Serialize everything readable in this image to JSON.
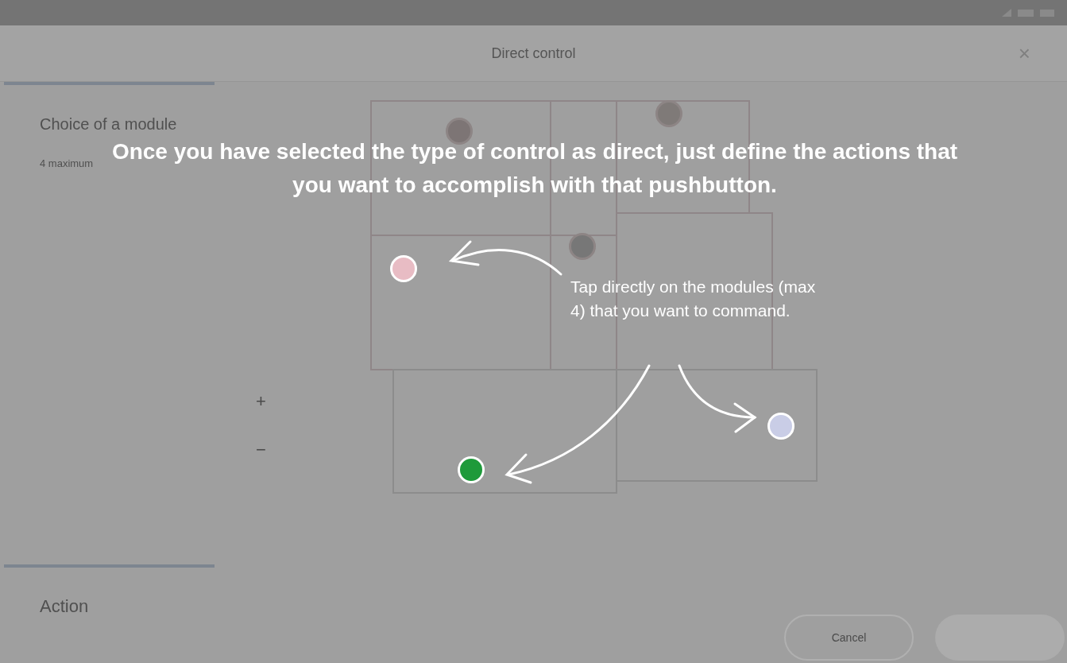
{
  "dialog": {
    "title": "Direct control",
    "close": "×"
  },
  "sidebar": {
    "module_heading": "Choice of a module",
    "module_hint": "4 maximum",
    "action_heading": "Action"
  },
  "zoom": {
    "plus": "+",
    "minus": "−"
  },
  "modules": [
    {
      "selected": false,
      "color": "#7d7575"
    },
    {
      "selected": false,
      "color": "#7f7a78"
    },
    {
      "selected": false,
      "color": "#777777"
    },
    {
      "selected": true,
      "color": "#e8bcc4"
    },
    {
      "selected": true,
      "color": "#1e9a3a"
    },
    {
      "selected": true,
      "color": "#c9cde6"
    }
  ],
  "buttons": [
    {
      "label": "Cancel",
      "kind": "outline"
    },
    {
      "kind": "filled"
    }
  ],
  "tutorial": {
    "headline": "Once you have selected the type of control as direct, just define the actions that you want to accomplish with that pushbutton.",
    "callout": "Tap directly on the modules (max 4) that you want to command."
  }
}
